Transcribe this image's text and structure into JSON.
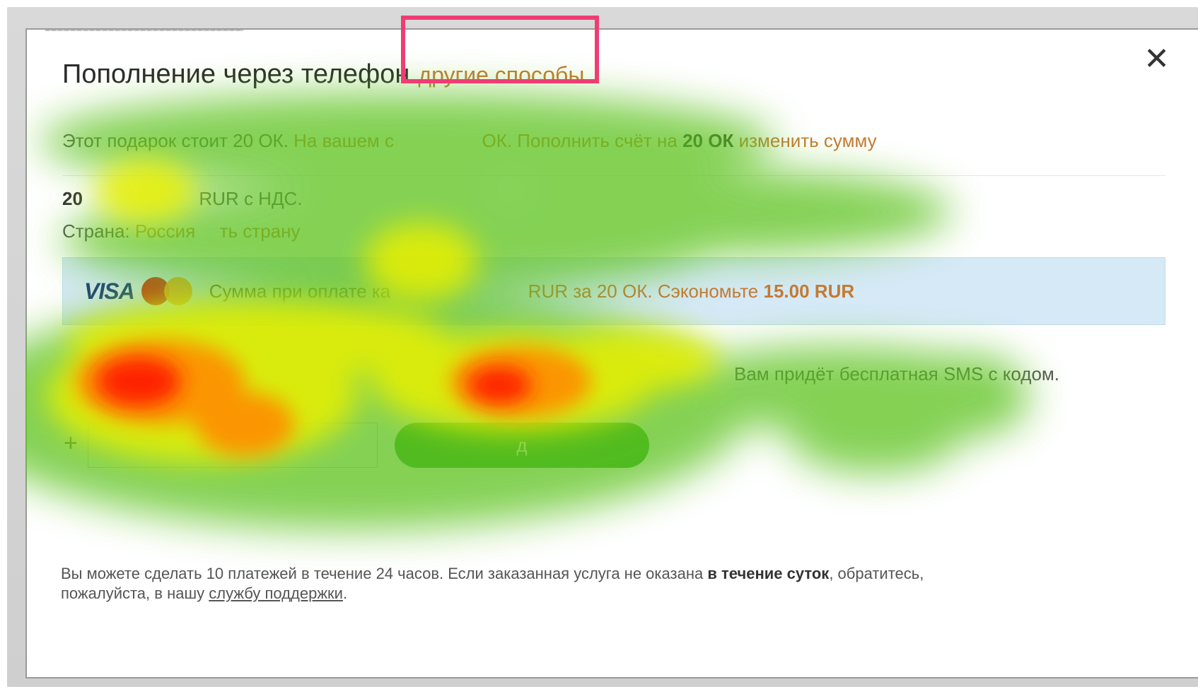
{
  "dialog": {
    "title": "Пополнение через телефон",
    "other_methods_link": "другие способы",
    "close_icon": "close-icon"
  },
  "price_line": {
    "part1": "Этот подарок стоит 20 ОК.",
    "part2": "На вашем с",
    "part3": "ОК. Пополнить счёт",
    "part4": "на",
    "part5": "20 ОК",
    "change_amount_link": "изменить сумму"
  },
  "amount_line": {
    "value": "20",
    "rest": "RUR с НДС."
  },
  "country_line": {
    "label": "Страна:",
    "value": "Россия",
    "change_link": "ть страну"
  },
  "card_banner": {
    "visa_label": "VISA",
    "text1": "Сумма при оплате ка",
    "text2": "RUR за 20 ОК.",
    "text3": "Сэкономьте",
    "savings": "15.00 RUR"
  },
  "sms_note": "Вам придёт бесплатная SMS с кодом.",
  "phone": {
    "prefix": "+",
    "value": ""
  },
  "get_code_button": "д",
  "footer": {
    "text1": "Вы можете сделать 10 платежей в течение 24 часов. Если заказанная услуга не оказана",
    "bold": "в течение суток",
    "text2": ", обратитесь,",
    "text3": "пожалуйста, в нашу",
    "support_link": "службу поддержки",
    "text4": "."
  },
  "colors": {
    "accent_orange": "#c47a34",
    "highlight_pink": "#ef3d74",
    "banner_blue": "#d5e9f6",
    "button_green": "#35a92d"
  }
}
